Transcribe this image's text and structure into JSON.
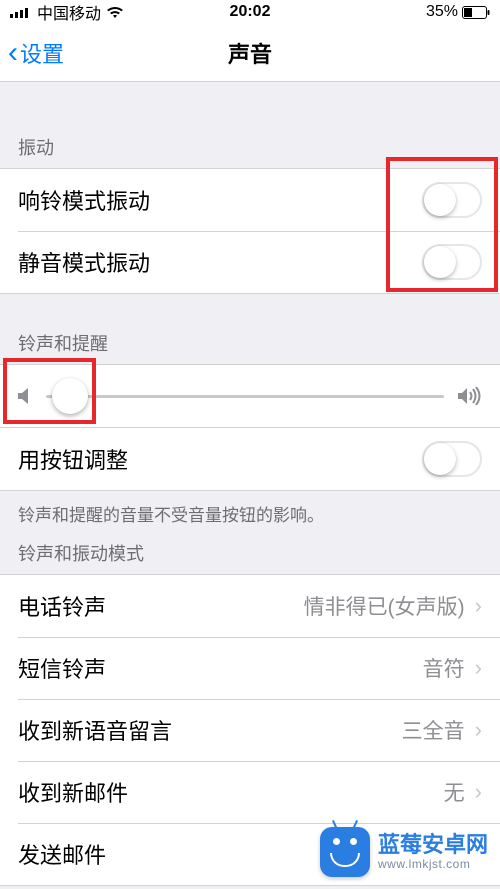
{
  "status": {
    "carrier": "中国移动",
    "time": "20:02",
    "battery_pct": "35%"
  },
  "nav": {
    "back_label": "设置",
    "title": "声音"
  },
  "sections": {
    "vibration_header": "振动",
    "ringtone_alerts_header": "铃声和提醒",
    "ringtone_pattern_header": "铃声和振动模式"
  },
  "rows": {
    "vibrate_on_ring": "响铃模式振动",
    "vibrate_on_silent": "静音模式振动",
    "change_with_buttons": "用按钮调整",
    "ringtone_label": "电话铃声",
    "ringtone_value": "情非得已(女声版)",
    "text_tone_label": "短信铃声",
    "text_tone_value": "音符",
    "new_voicemail_label": "收到新语音留言",
    "new_voicemail_value": "三全音",
    "new_mail_label": "收到新邮件",
    "new_mail_value": "无",
    "sent_mail_label": "发送邮件"
  },
  "footer": {
    "note": "铃声和提醒的音量不受音量按钮的影响。"
  },
  "watermark": {
    "line1": "蓝莓安卓网",
    "line2": "www.lmkjst.com"
  }
}
